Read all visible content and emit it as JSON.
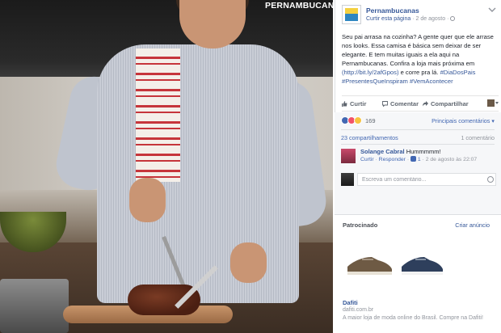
{
  "photo": {
    "brand_logo": "PERNAMBUCANAS"
  },
  "post": {
    "page_name": "Pernambucanas",
    "like_page": "Curtir esta página",
    "separator": "·",
    "date": "2 de agosto",
    "text_main": "Seu pai arrasa na cozinha? A gente quer que ele arrase nos looks. Essa camisa é básica sem deixar de ser elegante. E tem muitas iguais a ela aqui na Pernambucanas. Confira a loja mais próxima em",
    "link_url": "(http://bit.ly/2afGpos)",
    "text_mid": " e corre pra lá. ",
    "hashtags": "#DiaDosPais #PresentesQueInspiram #VemAcontecer"
  },
  "actions": {
    "like": "Curtir",
    "comment": "Comentar",
    "share": "Compartilhar"
  },
  "feedback": {
    "reaction_count": "169",
    "top_comments": "Principais comentários ▾",
    "shares": "23 compartilhamentos",
    "comment_count": "1 comentário"
  },
  "comment": {
    "author": "Solange Cabral",
    "text": "Hummmmm!",
    "like": "Curtir",
    "reply": "Responder",
    "likes": "1",
    "time": "2 de agosto às 22:07"
  },
  "write_comment": {
    "placeholder": "Escreva um comentário..."
  },
  "sponsored": {
    "title": "Patrocinado",
    "create_ad": "Criar anúncio",
    "ad_name": "Dafiti",
    "ad_url": "dafiti.com.br",
    "ad_desc": "A maior loja de moda online do Brasil. Compre na Dafiti!"
  },
  "colors": {
    "link_blue": "#365899",
    "accent_blue": "#4267b2",
    "muted_gray": "#90949c"
  }
}
